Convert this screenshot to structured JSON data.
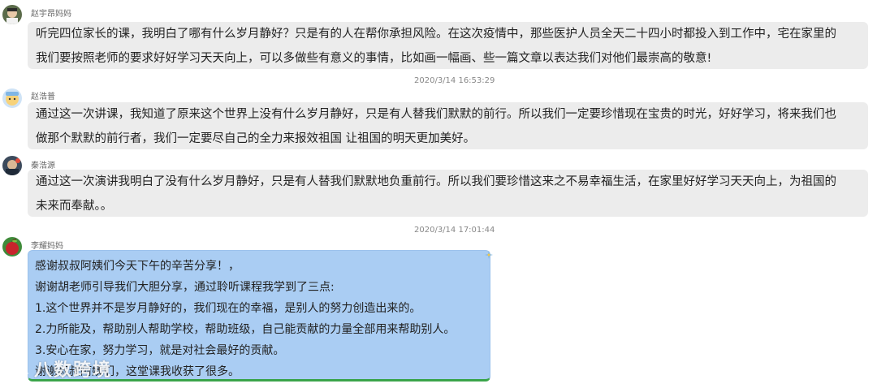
{
  "messages": [
    {
      "sender": "赵宇昂妈妈",
      "lines": [
        "听完四位家长的课，我明白了哪有什么岁月静好？只是有的人在帮你承担风险。在这次疫情中，那些医护人员全天二十四小时都投入到工作中，宅在家里的",
        "我们要按照老师的要求好好学习天天向上，可以多做些有意义的事情，比如画一幅画、些一篇文章以表达我们对他们最崇高的敬意!"
      ]
    },
    {
      "timestamp": "2020/3/14 16:53:29",
      "sender": "赵浩普",
      "lines": [
        "通过这一次讲课，我知道了原来这个世界上没有什么岁月静好，只是有人替我们默默的前行。所以我们一定要珍惜现在宝贵的时光，好好学习，将来我们也",
        "做那个默默的前行者，我们一定要尽自己的全力来报效祖国 让祖国的明天更加美好。"
      ]
    },
    {
      "sender": "秦浩源",
      "lines": [
        "通过这一次演讲我明白了没有什么岁月静好，只是有人替我们默默地负重前行。所以我们要珍惜这来之不易幸福生活，在家里好好学习天天向上，为祖国的",
        "未来而奉献。。"
      ]
    },
    {
      "timestamp": "2020/3/14 17:01:44",
      "sender": "李耀妈妈",
      "lines": [
        "感谢叔叔阿姨们今天下午的辛苦分享！，",
        "谢谢胡老师引导我们大胆分享，通过聆听课程我学到了三点:",
        "1.这个世界并不是岁月静好的，我们现在的幸福，是别人的努力创造出来的。",
        "2.力所能及，帮助别人帮助学校，帮助班级，自己能贡献的力量全部用来帮助别人。",
        "3.安心在家，努力学习，就是对社会最好的贡献。",
        "谢谢叔叔阿姨们，这堂课我收获了很多。"
      ]
    }
  ],
  "watermark": "八数跨境",
  "colors": {
    "bubble_gray": "#ececec",
    "bubble_blue": "#aacdf3",
    "bubble_blue_border": "#3aa44a",
    "sender_text": "#666666",
    "timestamp_text": "#888888"
  }
}
